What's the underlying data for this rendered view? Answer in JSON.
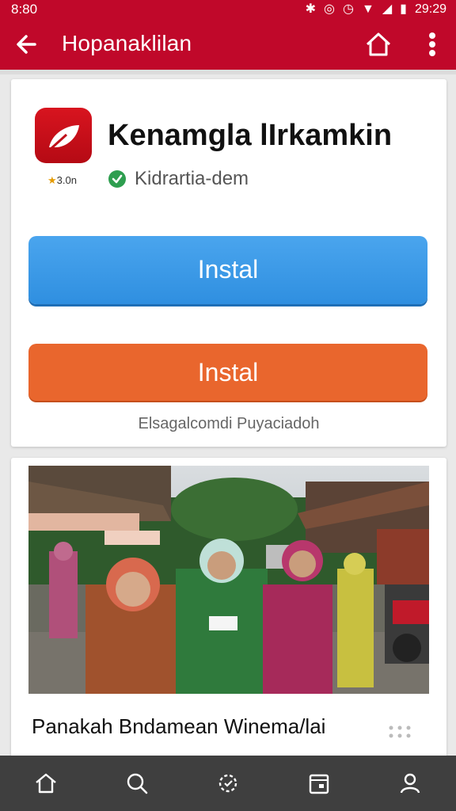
{
  "status_bar": {
    "left_time": "8:80",
    "right_time": "29:29",
    "icons": [
      "bluetooth-icon",
      "alarm-icon",
      "clock-icon",
      "wifi-icon",
      "signal-icon",
      "battery-icon"
    ]
  },
  "app_bar": {
    "title": "Hopanaklilan",
    "back_icon": "arrow-left-icon",
    "home_icon": "home-icon",
    "more_icon": "more-icon"
  },
  "app_card": {
    "name": "Kenamgla lIrkamkin",
    "rating": "3.0n",
    "developer": "Kidrartia-dem",
    "primary_button": "Instal",
    "secondary_button": "Instal",
    "footnote": "Elsagalcomdi Puyaciadoh"
  },
  "news_card": {
    "title": "Panakah Bndamean Winema/lai"
  },
  "bottom_nav": {
    "items": [
      "home-icon",
      "search-icon",
      "refresh-icon",
      "calendar-icon",
      "profile-icon"
    ]
  },
  "colors": {
    "accent": "#c0082a",
    "primary_button": "#3a98e8",
    "secondary_button": "#e9662d",
    "nav": "#3f3f3f"
  }
}
